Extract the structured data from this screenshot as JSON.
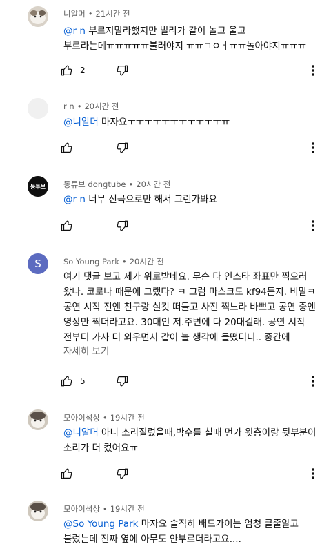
{
  "comments": [
    {
      "author": "니알머",
      "time": "21시간 전",
      "mention": "@r n",
      "text": " 부르지말라했지만 빌리가 같이 놀고 울고 부르라는데ㅠㅠㅠㅠㅠ불러야지 ㅠㅠㄱㅇㅓㅠㅠ놀아야지ㅠㅠㅠ",
      "likes": "2"
    },
    {
      "author": "r n",
      "time": "20시간 전",
      "mention": "@니알머",
      "text": " 마자요ㅜㅜㅜㅜㅜㅜㅜㅜㅜㅜㅜㅠ",
      "likes": ""
    },
    {
      "author": "동튜브 dongtube",
      "avatar_text": "동튜브",
      "time": "20시간 전",
      "mention": "@r n",
      "text": " 너무 신곡으로만 해서 그런가봐요",
      "likes": ""
    },
    {
      "author": "So Young Park",
      "avatar_text": "S",
      "time": "20시간 전",
      "mention": "",
      "text": "여기 댓글 보고 제가 위로받네요. 무슨 다 인스타 좌표만 찍으러 왔나. 코로나 때문에 그랬다? ㅋ 그럼 마스크도 kf94든지. 비말ㅋ 공연 시작 전엔 친구랑 실컷 떠들고 사진 찍느라 바쁘고 공연 중엔 영상만 찍더라고요. 30대인 저.주변에 다 20대길래. 공연 시작 전부터 가사 더 외우면서 같이 놀 생각에 들떴더니.. 중간에",
      "more": "자세히 보기",
      "likes": "5"
    },
    {
      "author": "모아이석상",
      "time": "19시간 전",
      "mention": "@니알머",
      "text": " 아니 소리질렀을때,박수를 칠때 먼가 윗층이랑 뒷부분이 소리가 더 컸어요ㅠ",
      "likes": ""
    },
    {
      "author": "모아이석상",
      "time": "19시간 전",
      "mention": "@So Young Park",
      "text": " 마자요 솔직히 배드가이는 엄청 클줄알고 불렀는데 진짜 옆에 아무도 안부르더라고요....",
      "likes": ""
    }
  ],
  "separator": "•",
  "colors": {
    "mention": "#065fd4",
    "meta": "#606060",
    "dongtube_bg": "#0f0f0f",
    "syp_bg": "#5c6bc0"
  }
}
